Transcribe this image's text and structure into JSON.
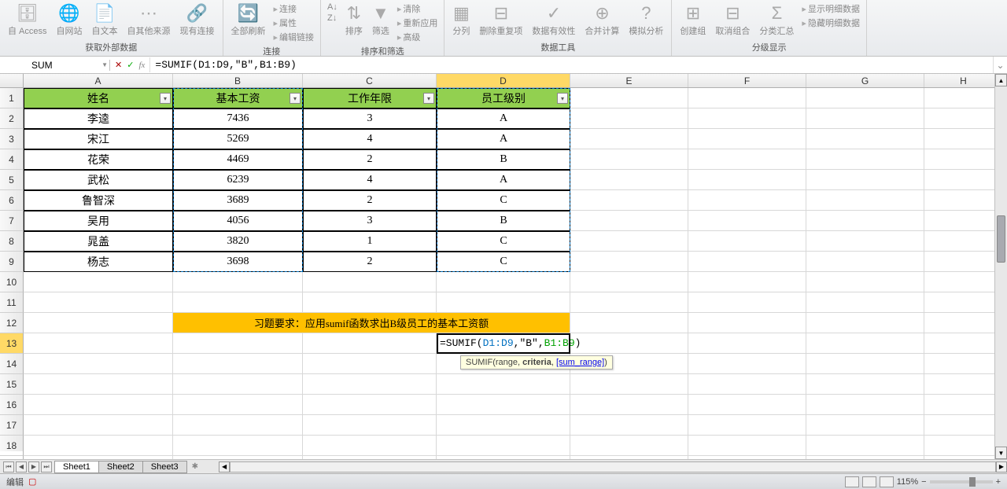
{
  "ribbon": {
    "groups": [
      {
        "label": "获取外部数据",
        "buttons": [
          "自 Access",
          "自网站",
          "自文本",
          "自其他来源",
          "现有连接"
        ],
        "icons": [
          "🗄",
          "🌐",
          "📄",
          "⋯",
          "🔗"
        ]
      },
      {
        "label": "连接",
        "buttons": [
          "全部刷新"
        ],
        "small": [
          "连接",
          "属性",
          "编辑链接"
        ],
        "icons": [
          "🔄"
        ]
      },
      {
        "label": "排序和筛选",
        "buttons": [
          "排序",
          "筛选"
        ],
        "small": [
          "清除",
          "重新应用",
          "高级"
        ],
        "icons_left": [
          "A↓",
          "Z↓"
        ],
        "icons": [
          "⇅",
          "▼"
        ]
      },
      {
        "label": "数据工具",
        "buttons": [
          "分列",
          "删除重复项",
          "数据有效性",
          "合并计算",
          "模拟分析"
        ],
        "icons": [
          "▦",
          "⊟",
          "✓",
          "⊕",
          "?"
        ]
      },
      {
        "label": "分级显示",
        "buttons": [
          "创建组",
          "取消组合",
          "分类汇总"
        ],
        "small": [
          "显示明细数据",
          "隐藏明细数据"
        ],
        "icons": [
          "⊞",
          "⊟",
          "Σ"
        ]
      }
    ]
  },
  "nameBox": "SUM",
  "formula": "=SUMIF(D1:D9,\"B\",B1:B9)",
  "columns": [
    "A",
    "B",
    "C",
    "D",
    "E",
    "F",
    "G",
    "H"
  ],
  "table": {
    "headers": [
      "姓名",
      "基本工资",
      "工作年限",
      "员工级别"
    ],
    "rows": [
      [
        "李逵",
        "7436",
        "3",
        "A"
      ],
      [
        "宋江",
        "5269",
        "4",
        "A"
      ],
      [
        "花荣",
        "4469",
        "2",
        "B"
      ],
      [
        "武松",
        "6239",
        "4",
        "A"
      ],
      [
        "鲁智深",
        "3689",
        "2",
        "C"
      ],
      [
        "吴用",
        "4056",
        "3",
        "B"
      ],
      [
        "晁盖",
        "3820",
        "1",
        "C"
      ],
      [
        "杨志",
        "3698",
        "2",
        "C"
      ]
    ]
  },
  "noteText": "习题要求：应用sumif函数求出B级员工的基本工资额",
  "cellFormula": {
    "prefix": "=SUMIF(",
    "arg1": "D1:D9",
    "sep1": ",",
    "arg2": "\"B\"",
    "sep2": ",",
    "arg3": "B1:B9",
    "suffix": ")"
  },
  "tooltip": {
    "fn": "SUMIF(",
    "p1": "range",
    "sep1": ", ",
    "p2": "criteria",
    "sep2": ", ",
    "p3": "[sum_range]",
    "close": ")"
  },
  "sheets": [
    "Sheet1",
    "Sheet2",
    "Sheet3"
  ],
  "status": {
    "mode": "编辑",
    "zoom": "115%"
  }
}
